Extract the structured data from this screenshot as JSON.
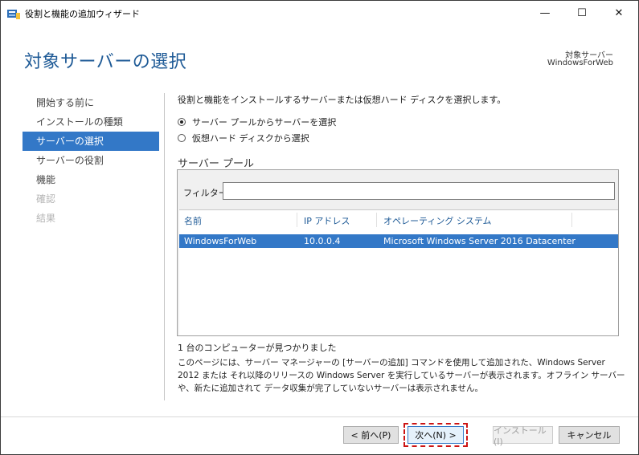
{
  "window": {
    "title": "役割と機能の追加ウィザード",
    "controls": {
      "minimize": "—",
      "maximize": "☐",
      "close": "✕"
    }
  },
  "header": {
    "page_title": "対象サーバーの選択",
    "destination_label": "対象サーバー",
    "destination_server": "WindowsForWeb"
  },
  "nav": {
    "items": [
      {
        "label": "開始する前に",
        "state": "normal"
      },
      {
        "label": "インストールの種類",
        "state": "normal"
      },
      {
        "label": "サーバーの選択",
        "state": "active"
      },
      {
        "label": "サーバーの役割",
        "state": "normal"
      },
      {
        "label": "機能",
        "state": "normal"
      },
      {
        "label": "確認",
        "state": "disabled"
      },
      {
        "label": "結果",
        "state": "disabled"
      }
    ]
  },
  "content": {
    "description": "役割と機能をインストールするサーバーまたは仮想ハード ディスクを選択します。",
    "radio_pool": "サーバー プールからサーバーを選択",
    "radio_vhd": "仮想ハード ディスクから選択",
    "pool_title": "サーバー プール",
    "filter_label": "フィルター:",
    "filter_value": "",
    "columns": [
      "名前",
      "IP アドレス",
      "オペレーティング システム"
    ],
    "rows": [
      {
        "name": "WindowsForWeb",
        "ip": "10.0.0.4",
        "os": "Microsoft Windows Server 2016 Datacenter"
      }
    ],
    "found_text": "1 台のコンピューターが見つかりました",
    "note": "このページには、サーバー マネージャーの [サーバーの追加] コマンドを使用して追加された、Windows Server 2012 または それ以降のリリースの Windows Server を実行しているサーバーが表示されます。オフライン サーバーや、新たに追加されて データ収集が完了していないサーバーは表示されません。"
  },
  "footer": {
    "prev": "< 前へ(P)",
    "next": "次へ(N) >",
    "install": "インストール(I)",
    "cancel": "キャンセル"
  },
  "colors": {
    "accent": "#3378c7",
    "title_blue": "#1e5a96",
    "highlight": "#cc1414"
  }
}
